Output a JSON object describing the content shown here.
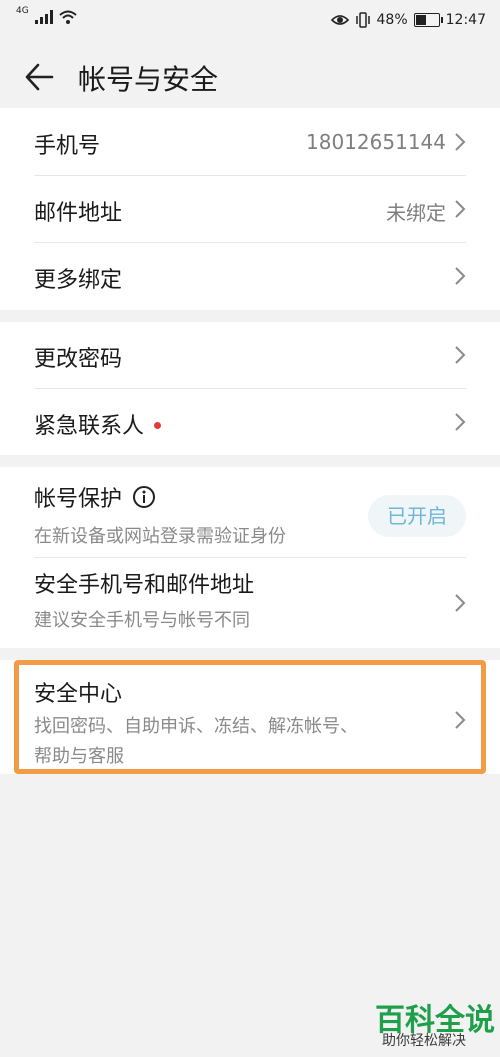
{
  "status_bar": {
    "network": "4G",
    "battery": "48%",
    "battery_level": 0.48,
    "time": "12:47"
  },
  "header": {
    "title": "帐号与安全"
  },
  "groups": [
    {
      "items": [
        {
          "label": "手机号",
          "value": "18012651144"
        },
        {
          "label": "邮件地址",
          "value": "未绑定"
        },
        {
          "label": "更多绑定",
          "value": ""
        }
      ]
    },
    {
      "items": [
        {
          "label": "更改密码"
        },
        {
          "label": "紧急联系人",
          "has_alert_dot": true
        }
      ]
    },
    {
      "items": [
        {
          "label": "帐号保护",
          "sub": "在新设备或网站登录需验证身份",
          "badge": "已开启"
        },
        {
          "label": "安全手机号和邮件地址",
          "sub": "建议安全手机号与帐号不同"
        }
      ]
    },
    {
      "items": [
        {
          "label": "安全中心",
          "sub_lines": [
            "找回密码、自助申诉、冻结、解冻帐号、",
            "帮助与客服"
          ]
        }
      ]
    }
  ],
  "watermark": {
    "title": "百科全说",
    "subtitle": "助你轻松解决"
  },
  "colors": {
    "highlight": "#f39c48",
    "badge_text": "#6fb6d8",
    "alert_dot": "#e53935",
    "watermark": "#1ea04a"
  }
}
